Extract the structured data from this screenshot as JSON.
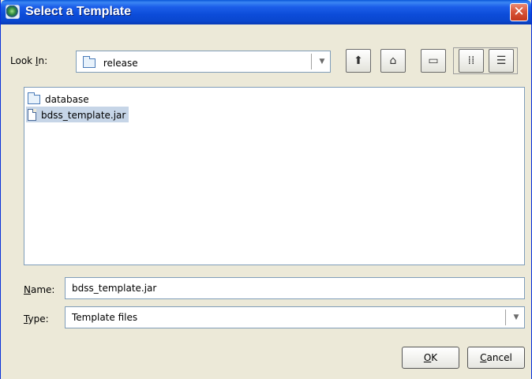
{
  "window": {
    "title": "Select a Template",
    "close_glyph": "✕"
  },
  "look_in": {
    "label_prefix": "Look ",
    "label_mnemonic": "I",
    "label_suffix": "n:",
    "value": "release",
    "icon": "folder-icon"
  },
  "toolbar": {
    "buttons": [
      {
        "name": "up-one-level",
        "icon": "up-folder-icon",
        "glyph": "⬆"
      },
      {
        "name": "home",
        "icon": "home-icon",
        "glyph": "⌂"
      },
      {
        "name": "new-folder",
        "icon": "new-folder-icon",
        "glyph": "▭"
      },
      {
        "name": "list-view",
        "icon": "list-view-icon",
        "glyph": "⁞⁞"
      },
      {
        "name": "details-view",
        "icon": "details-view-icon",
        "glyph": "☰"
      }
    ]
  },
  "files": [
    {
      "name": "database",
      "type": "folder",
      "icon": "folder-icon",
      "selected": false
    },
    {
      "name": "bdss_template.jar",
      "type": "file",
      "icon": "file-icon",
      "selected": true
    }
  ],
  "name_field": {
    "label_mnemonic": "N",
    "label_suffix": "ame:",
    "value": "bdss_template.jar"
  },
  "type_field": {
    "label_mnemonic": "T",
    "label_suffix": "ype:",
    "value": "Template files"
  },
  "buttons": {
    "ok_mnemonic": "O",
    "ok_suffix": "K",
    "cancel_mnemonic": "C",
    "cancel_suffix": "ancel"
  },
  "colors": {
    "titlebar": "#0a47cf",
    "close": "#d9563a",
    "selection": "#c6d5e7",
    "dialog_bg": "#ece9d8"
  }
}
